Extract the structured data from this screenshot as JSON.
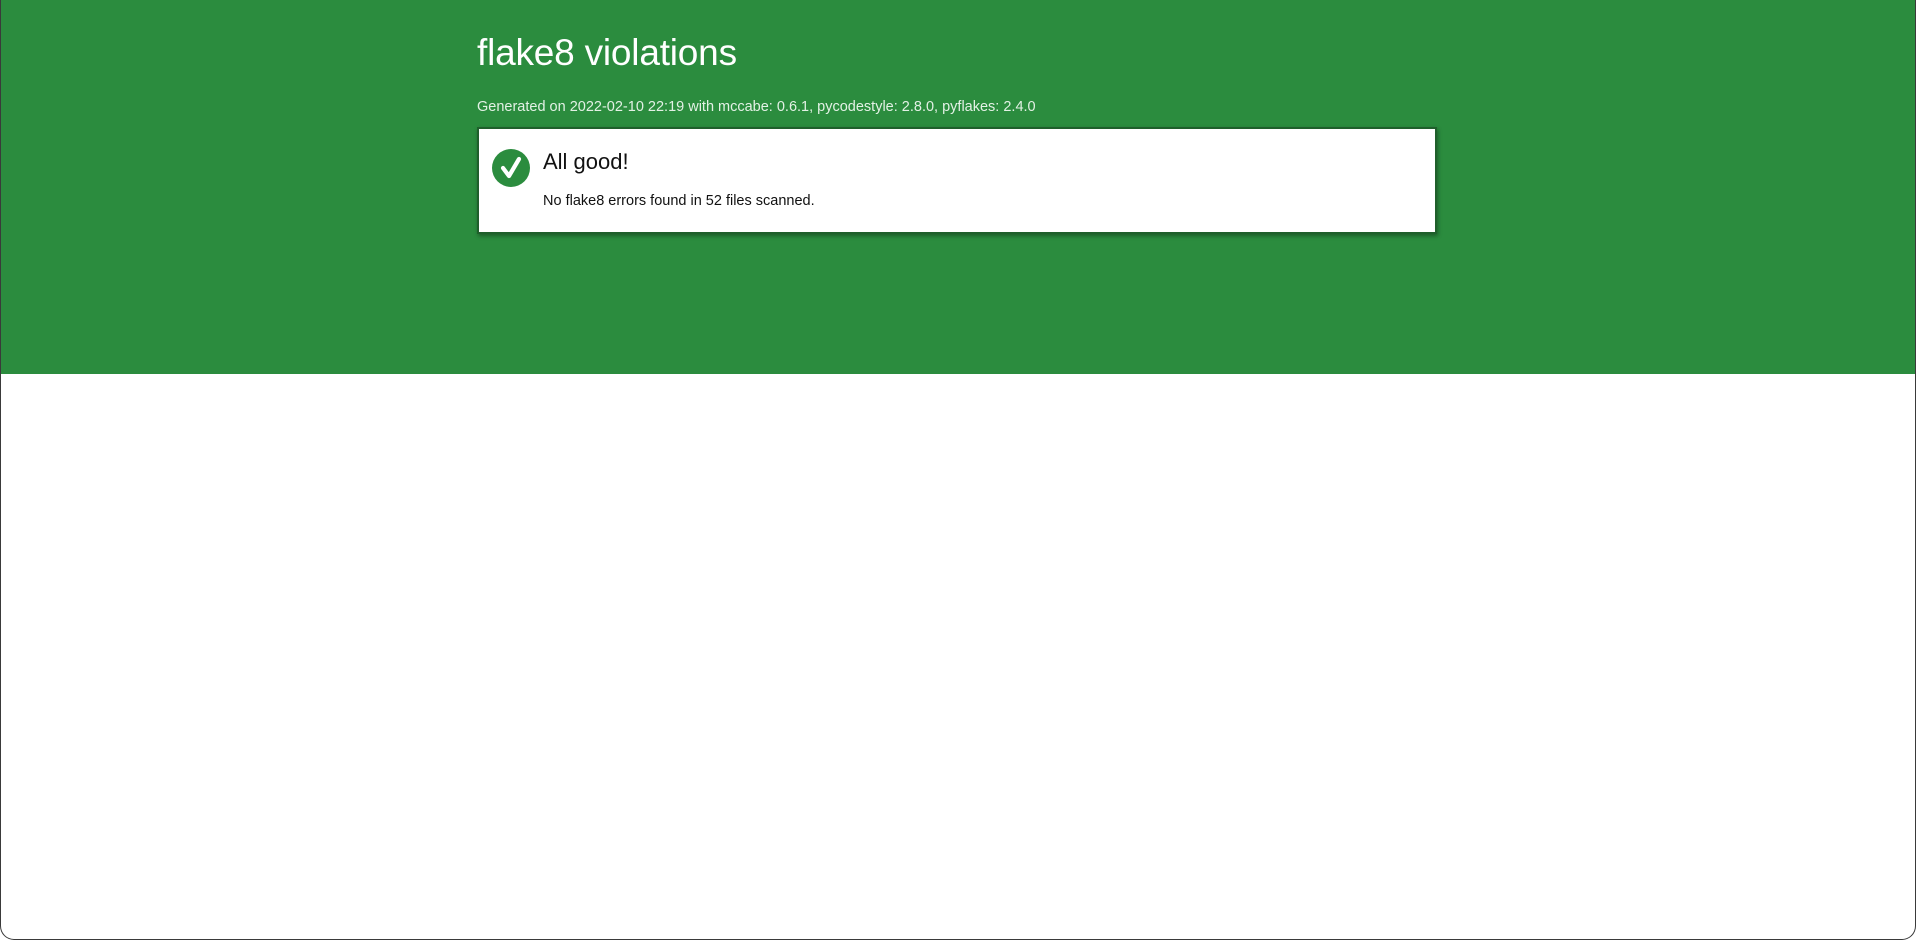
{
  "header": {
    "title": "flake8 violations",
    "generated": "Generated on 2022-02-10 22:19 with mccabe: 0.6.1, pycodestyle: 2.8.0, pyflakes: 2.4.0"
  },
  "result": {
    "icon": "checkmark-icon",
    "heading": "All good!",
    "message": "No flake8 errors found in 52 files scanned."
  },
  "colors": {
    "banner": "#2b8c3e",
    "card_border": "#1f5f2b",
    "background": "#ffffff"
  }
}
